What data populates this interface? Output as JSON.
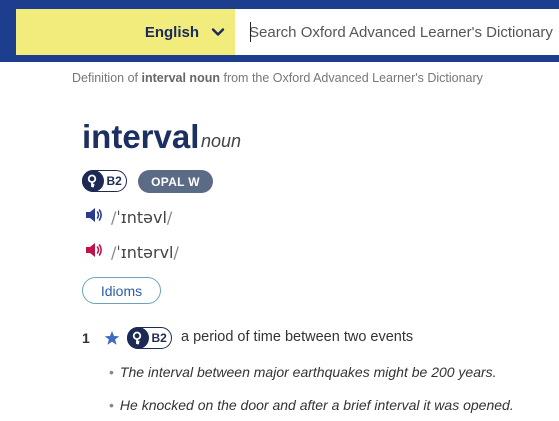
{
  "header": {
    "language": "English",
    "search_placeholder": "Search Oxford Advanced Learner's Dictionary",
    "accent_colors": {
      "bar": "#1d3e8f",
      "language": "#f1ec7c"
    }
  },
  "breadcrumb": {
    "prefix": "Definition of",
    "entry": "interval noun",
    "suffix": "from the Oxford Advanced Learner's Dictionary"
  },
  "entry": {
    "headword": "interval",
    "pos": "noun",
    "cefr": "B2",
    "opal": "OPAL W",
    "pronunciations": [
      {
        "variant": "uk",
        "icon": "speaker-blue-icon",
        "color": "#2b3a8f",
        "ipa": "ˈɪntəvl"
      },
      {
        "variant": "us",
        "icon": "speaker-red-icon",
        "color": "#c0134b",
        "ipa": "ˈɪntərvl"
      }
    ],
    "idioms_label": "Idioms"
  },
  "senses": [
    {
      "number": "1",
      "cefr": "B2",
      "definition": "a period of time between two events",
      "examples": [
        "The interval between major earthquakes might be 200 years.",
        "He knocked on the door and after a brief interval it was opened."
      ]
    }
  ]
}
